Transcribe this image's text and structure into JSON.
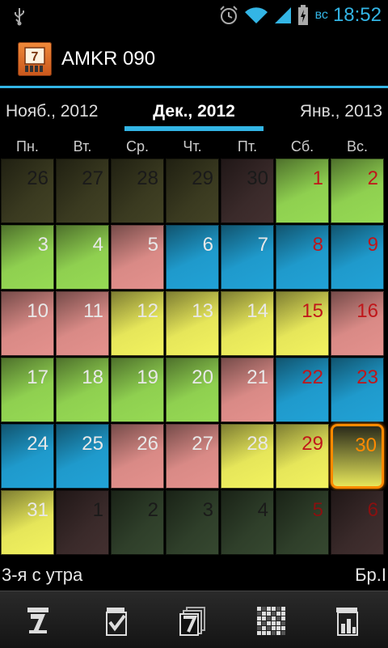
{
  "status": {
    "day": "вс",
    "time": "18:52"
  },
  "app": {
    "title": "AMKR 090"
  },
  "months": {
    "prev": "Нояб., 2012",
    "current": "Дек., 2012",
    "next": "Янв., 2013"
  },
  "weekdays": [
    "Пн.",
    "Вт.",
    "Ср.",
    "Чт.",
    "Пт.",
    "Сб.",
    "Вс."
  ],
  "days": [
    [
      "26",
      "27",
      "28",
      "29",
      "30",
      "1",
      "2"
    ],
    [
      "3",
      "4",
      "5",
      "6",
      "7",
      "8",
      "9"
    ],
    [
      "10",
      "11",
      "12",
      "13",
      "14",
      "15",
      "16"
    ],
    [
      "17",
      "18",
      "19",
      "20",
      "21",
      "22",
      "23"
    ],
    [
      "24",
      "25",
      "26",
      "27",
      "28",
      "29",
      "30"
    ],
    [
      "31",
      "1",
      "2",
      "3",
      "4",
      "5",
      "6"
    ]
  ],
  "cell_colors": [
    [
      "olive-dark",
      "olive-dark",
      "olive-dark",
      "olive-dark",
      "maroon-dark",
      "green",
      "green"
    ],
    [
      "green",
      "green",
      "pink",
      "blue",
      "blue",
      "blue",
      "blue"
    ],
    [
      "pink",
      "pink",
      "yellow",
      "yellow",
      "yellow",
      "yellow",
      "pink"
    ],
    [
      "green",
      "green",
      "green",
      "green",
      "pink",
      "blue",
      "blue"
    ],
    [
      "blue",
      "blue",
      "pink",
      "pink",
      "yellow",
      "yellow",
      "yellow"
    ],
    [
      "yellow",
      "maroon-dark",
      "green-dark",
      "green-dark",
      "green-dark",
      "green-dark",
      "maroon-dark"
    ]
  ],
  "today": {
    "row": 4,
    "col": 6
  },
  "palette": {
    "green": "#8fd050",
    "yellow": "#e6e65a",
    "pink": "#d98a86",
    "blue": "#1f9acc",
    "olive-dark": "#3a3a20",
    "maroon-dark": "#3a2a2a",
    "green-dark": "#2f3f2a",
    "accent": "#33b5e5",
    "today_border": "#ff8a00",
    "weekend_red": "#c0161a"
  },
  "info": {
    "left": "3-я с утра",
    "right": "Бр.I"
  },
  "bottom_icons": [
    "calendar-7-icon",
    "checkmark-icon",
    "calendar-stack-icon",
    "pattern-grid-icon",
    "bar-chart-icon"
  ]
}
